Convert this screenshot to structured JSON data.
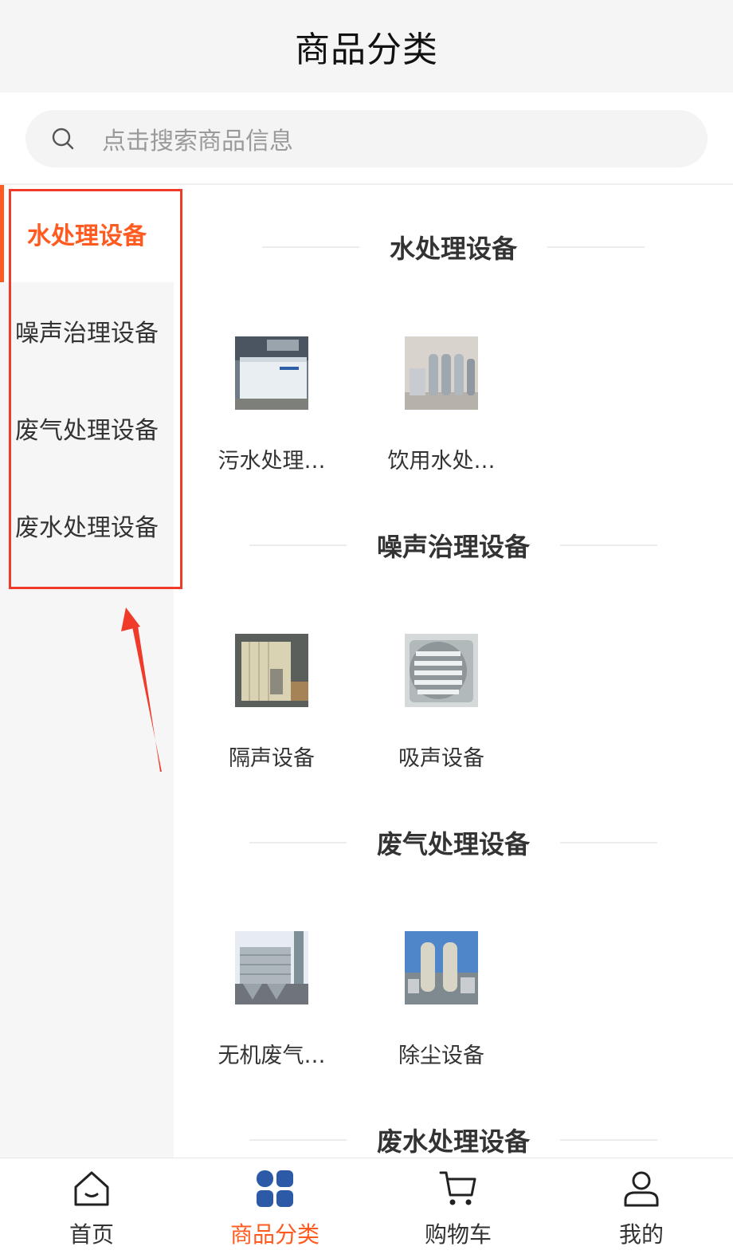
{
  "header": {
    "title": "商品分类"
  },
  "search": {
    "placeholder": "点击搜索商品信息"
  },
  "sidebar": {
    "items": [
      {
        "label": "水处理设备",
        "active": true
      },
      {
        "label": "噪声治理设备",
        "active": false
      },
      {
        "label": "废气处理设备",
        "active": false
      },
      {
        "label": "废水处理设备",
        "active": false
      }
    ]
  },
  "sections": [
    {
      "title": "水处理设备",
      "products": [
        {
          "name": "污水处理…"
        },
        {
          "name": "饮用水处…"
        }
      ]
    },
    {
      "title": "噪声治理设备",
      "products": [
        {
          "name": "隔声设备"
        },
        {
          "name": "吸声设备"
        }
      ]
    },
    {
      "title": "废气处理设备",
      "products": [
        {
          "name": "无机废气…"
        },
        {
          "name": "除尘设备"
        }
      ]
    },
    {
      "title": "废水处理设备",
      "products": []
    }
  ],
  "tabbar": {
    "items": [
      {
        "label": "首页",
        "icon": "home-icon",
        "active": false
      },
      {
        "label": "商品分类",
        "icon": "category-icon",
        "active": true
      },
      {
        "label": "购物车",
        "icon": "cart-icon",
        "active": false
      },
      {
        "label": "我的",
        "icon": "user-icon",
        "active": false
      }
    ]
  },
  "colors": {
    "accent": "#ff5a1f",
    "annotation": "#f03a2a",
    "active_icon": "#2d5aa6"
  }
}
